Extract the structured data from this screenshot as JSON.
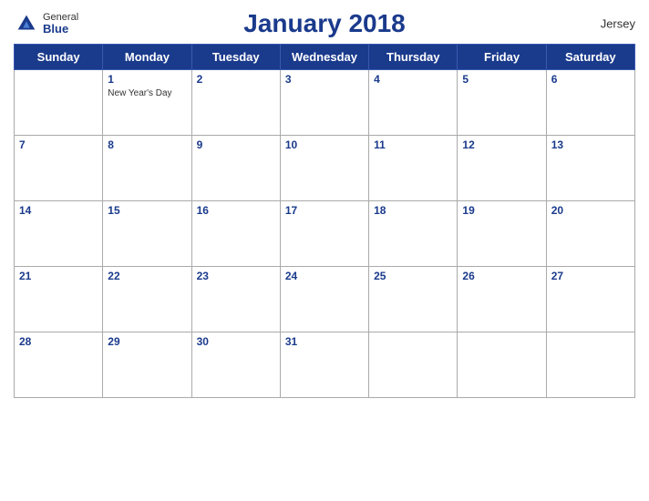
{
  "header": {
    "title": "January 2018",
    "region": "Jersey",
    "logo_general": "General",
    "logo_blue": "Blue"
  },
  "days_of_week": [
    "Sunday",
    "Monday",
    "Tuesday",
    "Wednesday",
    "Thursday",
    "Friday",
    "Saturday"
  ],
  "weeks": [
    [
      {
        "day": "",
        "empty": true
      },
      {
        "day": "1",
        "holiday": "New Year's Day"
      },
      {
        "day": "2",
        "holiday": ""
      },
      {
        "day": "3",
        "holiday": ""
      },
      {
        "day": "4",
        "holiday": ""
      },
      {
        "day": "5",
        "holiday": ""
      },
      {
        "day": "6",
        "holiday": ""
      }
    ],
    [
      {
        "day": "7",
        "holiday": ""
      },
      {
        "day": "8",
        "holiday": ""
      },
      {
        "day": "9",
        "holiday": ""
      },
      {
        "day": "10",
        "holiday": ""
      },
      {
        "day": "11",
        "holiday": ""
      },
      {
        "day": "12",
        "holiday": ""
      },
      {
        "day": "13",
        "holiday": ""
      }
    ],
    [
      {
        "day": "14",
        "holiday": ""
      },
      {
        "day": "15",
        "holiday": ""
      },
      {
        "day": "16",
        "holiday": ""
      },
      {
        "day": "17",
        "holiday": ""
      },
      {
        "day": "18",
        "holiday": ""
      },
      {
        "day": "19",
        "holiday": ""
      },
      {
        "day": "20",
        "holiday": ""
      }
    ],
    [
      {
        "day": "21",
        "holiday": ""
      },
      {
        "day": "22",
        "holiday": ""
      },
      {
        "day": "23",
        "holiday": ""
      },
      {
        "day": "24",
        "holiday": ""
      },
      {
        "day": "25",
        "holiday": ""
      },
      {
        "day": "26",
        "holiday": ""
      },
      {
        "day": "27",
        "holiday": ""
      }
    ],
    [
      {
        "day": "28",
        "holiday": ""
      },
      {
        "day": "29",
        "holiday": ""
      },
      {
        "day": "30",
        "holiday": ""
      },
      {
        "day": "31",
        "holiday": ""
      },
      {
        "day": "",
        "empty": true
      },
      {
        "day": "",
        "empty": true
      },
      {
        "day": "",
        "empty": true
      }
    ]
  ]
}
